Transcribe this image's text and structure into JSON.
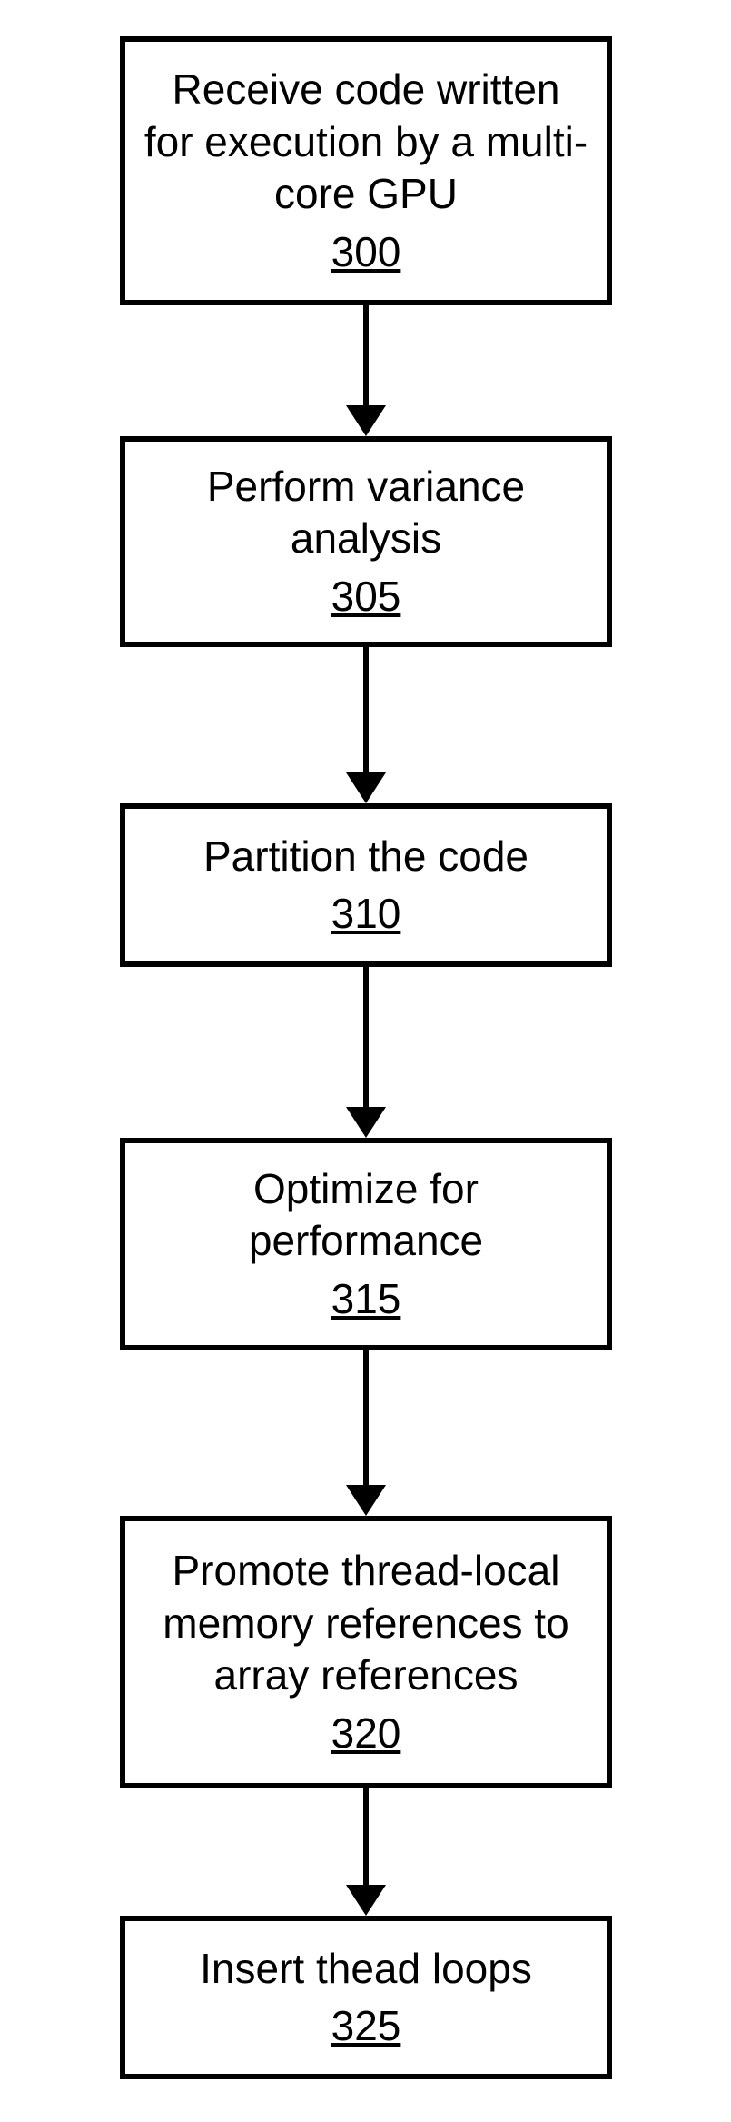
{
  "steps": [
    {
      "text": "Receive code written for execution by a multi-core GPU",
      "ref": "300"
    },
    {
      "text": "Perform variance analysis",
      "ref": "305"
    },
    {
      "text": "Partition the code",
      "ref": "310"
    },
    {
      "text": "Optimize for performance",
      "ref": "315"
    },
    {
      "text": "Promote thread-local memory references to array references",
      "ref": "320"
    },
    {
      "text": "Insert thead loops",
      "ref": "325"
    }
  ]
}
